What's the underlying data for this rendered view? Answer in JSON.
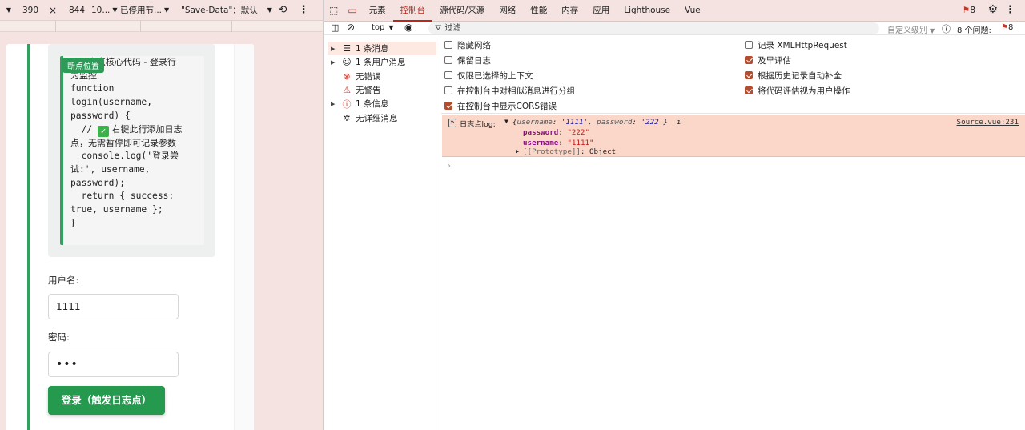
{
  "device_toolbar": {
    "width": "390",
    "times": "×",
    "height": "844",
    "zoom": "10...",
    "throttle": "已停用节...",
    "save_data": "\"Save-Data\"：默认"
  },
  "page": {
    "breakpoint_badge": "断点位置",
    "code_lines": [
      "// 日志点核心代码 - 登录行",
      "为监控",
      "function",
      "login(username,",
      "password) {",
      "  // ✅ 右键此行添加日志",
      "点，无需暂停即可记录参数",
      "  console.log('登录尝",
      "试:', username,",
      "password);",
      "  return { success:",
      "true, username };",
      "}"
    ],
    "username_label": "用户名:",
    "username_value": "1111",
    "password_label": "密码:",
    "password_value": "•••",
    "login_button": "登录（触发日志点）"
  },
  "devtools": {
    "tabs": [
      "元素",
      "控制台",
      "源代码/来源",
      "网络",
      "性能",
      "内存",
      "应用",
      "Lighthouse",
      "Vue"
    ],
    "active_tab": "控制台",
    "issues_badge": "8",
    "context": "top",
    "filter_placeholder": "过滤",
    "levels": "自定义级别",
    "issues_count_label": "8 个问题:",
    "issues_count": "8",
    "sidebar": [
      {
        "label": "1 条消息",
        "icon": "list-icon",
        "expandable": true
      },
      {
        "label": "1 条用户消息",
        "icon": "user-icon",
        "expandable": true
      },
      {
        "label": "无错误",
        "icon": "error-icon",
        "expandable": false
      },
      {
        "label": "无警告",
        "icon": "warning-icon",
        "expandable": false
      },
      {
        "label": "1 条信息",
        "icon": "info-icon",
        "expandable": true
      },
      {
        "label": "无详细消息",
        "icon": "bug-icon",
        "expandable": false
      }
    ],
    "settings_left": [
      {
        "label": "隐藏网络",
        "checked": false
      },
      {
        "label": "保留日志",
        "checked": false
      },
      {
        "label": "仅限已选择的上下文",
        "checked": false
      },
      {
        "label": "在控制台中对相似消息进行分组",
        "checked": false
      },
      {
        "label": "在控制台中显示CORS错误",
        "checked": true
      }
    ],
    "settings_right": [
      {
        "label": "记录 XMLHttpRequest",
        "checked": false
      },
      {
        "label": "及早评估",
        "checked": true
      },
      {
        "label": "根据历史记录自动补全",
        "checked": true
      },
      {
        "label": "将代码评估视为用户操作",
        "checked": true
      }
    ],
    "log": {
      "prefix": "日志点log:",
      "summary_open": "{",
      "k1": "username",
      "v1": "'1111'",
      "k2": "password",
      "v2": "'222'",
      "summary_close": "}",
      "info": "i",
      "source": "Source.vue:231",
      "pw_key": "password",
      "pw_val": "\"222\"",
      "un_key": "username",
      "un_val": "\"1111\"",
      "proto_key": "[[Prototype]]",
      "proto_val": "Object"
    },
    "prompt": "›"
  }
}
